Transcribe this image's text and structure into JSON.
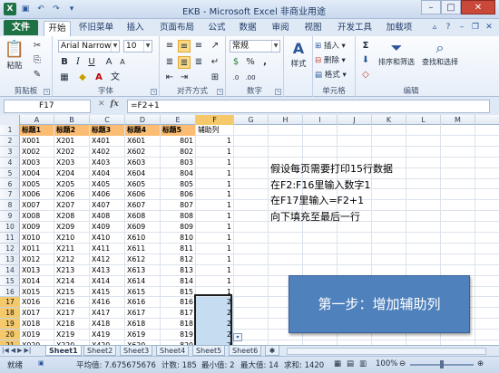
{
  "window": {
    "title": "EKB - Microsoft Excel 非商业用途",
    "min_icon": "minimize-icon",
    "max_icon": "maximize-icon",
    "close_icon": "close-icon"
  },
  "qat": {
    "icons": [
      "excel-logo-icon",
      "save-icon",
      "undo-icon",
      "redo-icon",
      "customize-icon"
    ]
  },
  "tabs": {
    "file": "文件",
    "items": [
      "开始",
      "怀旧菜单",
      "插入",
      "页面布局",
      "公式",
      "数据",
      "审阅",
      "视图",
      "开发工具",
      "加载项"
    ],
    "active": 0
  },
  "ribbon": {
    "clipboard": {
      "label": "剪贴板",
      "paste": "粘贴"
    },
    "font": {
      "label": "字体",
      "name": "Arial Narrow",
      "size": "10",
      "bold": "B",
      "italic": "I",
      "underline": "U"
    },
    "align": {
      "label": "对齐方式"
    },
    "number": {
      "label": "数字",
      "format": "常规",
      "percent": "%",
      "comma": ","
    },
    "styles": {
      "label": "样式"
    },
    "cells": {
      "label": "单元格",
      "insert": "插入",
      "delete": "删除",
      "format": "格式"
    },
    "editing": {
      "label": "编辑",
      "sigma": "Σ",
      "sort_filter": "排序和筛选",
      "find_select": "查找和选择"
    }
  },
  "formula": {
    "namebox": "F17",
    "fx": "fx",
    "value": "=F2+1"
  },
  "columns": [
    "A",
    "B",
    "C",
    "D",
    "E",
    "F",
    "G",
    "H",
    "I",
    "J",
    "K",
    "L",
    "M"
  ],
  "rows": [
    "1",
    "2",
    "3",
    "4",
    "5",
    "6",
    "7",
    "8",
    "9",
    "10",
    "11",
    "12",
    "13",
    "14",
    "15",
    "16",
    "17",
    "18",
    "19",
    "20",
    "21"
  ],
  "header_row": [
    "标题1",
    "标题2",
    "标题3",
    "标题4",
    "标题5",
    "辅助列"
  ],
  "data_rows": [
    [
      "X001",
      "X201",
      "X401",
      "X601",
      "801",
      "1"
    ],
    [
      "X002",
      "X202",
      "X402",
      "X602",
      "802",
      "1"
    ],
    [
      "X003",
      "X203",
      "X403",
      "X603",
      "803",
      "1"
    ],
    [
      "X004",
      "X204",
      "X404",
      "X604",
      "804",
      "1"
    ],
    [
      "X005",
      "X205",
      "X405",
      "X605",
      "805",
      "1"
    ],
    [
      "X006",
      "X206",
      "X406",
      "X606",
      "806",
      "1"
    ],
    [
      "X007",
      "X207",
      "X407",
      "X607",
      "807",
      "1"
    ],
    [
      "X008",
      "X208",
      "X408",
      "X608",
      "808",
      "1"
    ],
    [
      "X009",
      "X209",
      "X409",
      "X609",
      "809",
      "1"
    ],
    [
      "X010",
      "X210",
      "X410",
      "X610",
      "810",
      "1"
    ],
    [
      "X011",
      "X211",
      "X411",
      "X611",
      "811",
      "1"
    ],
    [
      "X012",
      "X212",
      "X412",
      "X612",
      "812",
      "1"
    ],
    [
      "X013",
      "X213",
      "X413",
      "X613",
      "813",
      "1"
    ],
    [
      "X014",
      "X214",
      "X414",
      "X614",
      "814",
      "1"
    ],
    [
      "X015",
      "X215",
      "X415",
      "X615",
      "815",
      "1"
    ],
    [
      "X016",
      "X216",
      "X416",
      "X616",
      "816",
      "2"
    ],
    [
      "X017",
      "X217",
      "X417",
      "X617",
      "817",
      "2"
    ],
    [
      "X018",
      "X218",
      "X418",
      "X618",
      "818",
      "2"
    ],
    [
      "X019",
      "X219",
      "X419",
      "X619",
      "819",
      "2"
    ],
    [
      "X020",
      "X220",
      "X420",
      "X620",
      "820",
      "2"
    ]
  ],
  "notes": [
    "假设每页需要打印15行数据",
    "在F2:F16里输入数字1",
    "在F17里输入=F2+1",
    "向下填充至最后一行"
  ],
  "callout": "第一步：增加辅助列",
  "sheets": [
    "Sheet1",
    "Sheet2",
    "Sheet3",
    "Sheet4",
    "Sheet5",
    "Sheet6"
  ],
  "status": {
    "ready": "就绪",
    "average": "平均值: 7.675675676",
    "count": "计数: 185",
    "max": "最小值: 2",
    "min": "最大值: 14",
    "sum": "求和: 1420",
    "zoom": "100%"
  }
}
